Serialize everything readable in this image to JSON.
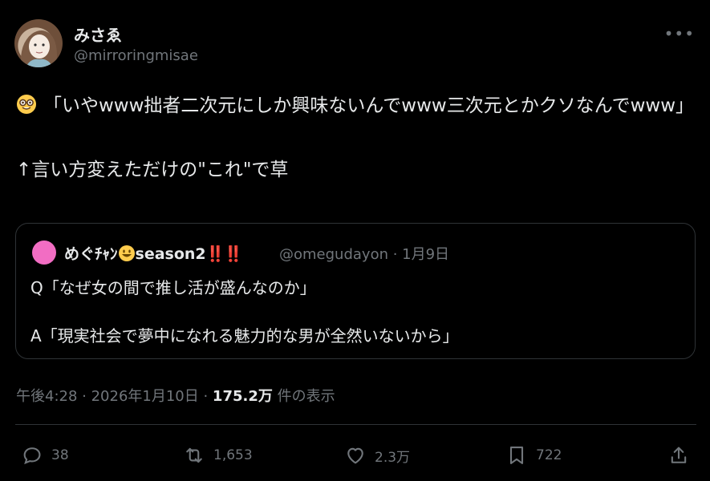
{
  "author": {
    "display_name": "みさゑ",
    "handle": "@mirroringmisae"
  },
  "tweet": {
    "text": "「いやwww拙者二次元にしか興味ないんでwww三次元とかクソなんでwww」\n\n↑言い方変えただけの\"これ\"で草",
    "timestamp": "午後4:28 · 2026年1月10日 · ",
    "views_count": "175.2万",
    "views_label": " 件の表示"
  },
  "quote": {
    "name_prefix": "めぐﾁｬﾝ",
    "name_suffix": "season2",
    "name_bangs": "‼️‼️",
    "meta": "@omegudayon · 1月9日",
    "line1": "Q「なぜ女の間で推し活が盛んなのか」",
    "line2": "A「現実社会で夢中になれる魅力的な男が全然いないから」"
  },
  "actions": {
    "reply_count": "38",
    "retweet_count": "1,653",
    "like_count": "2.3万",
    "bookmark_count": "722"
  },
  "icons": {
    "more": "more-icon",
    "reply": "reply-icon",
    "retweet": "retweet-icon",
    "like": "like-icon",
    "bookmark": "bookmark-icon",
    "share": "share-icon",
    "nerd_emoji": "nerd-face-emoji",
    "smile_emoji": "grinning-face-emoji"
  },
  "colors": {
    "background": "#000000",
    "text": "#e7e9ea",
    "muted": "#71767b",
    "border": "#2f3336",
    "quote_avatar": "#f26dc3",
    "bangs": "#f4212e"
  }
}
